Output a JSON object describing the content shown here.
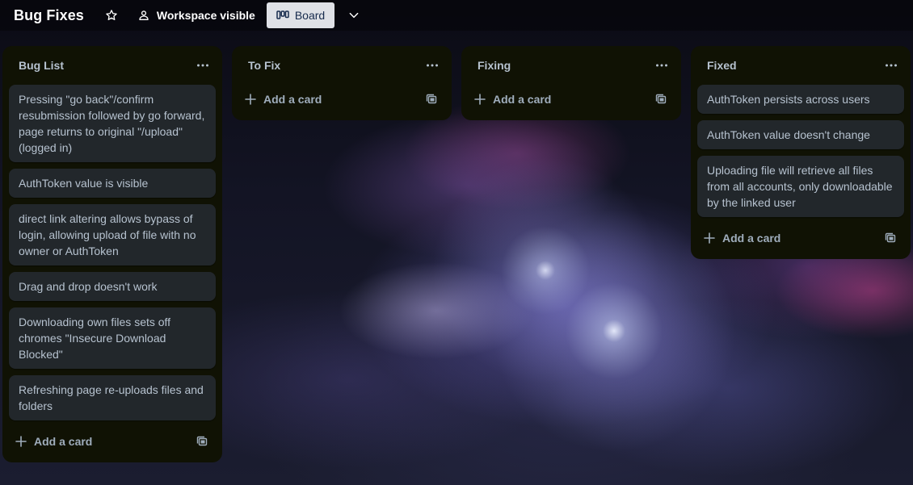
{
  "header": {
    "board_title": "Bug Fixes",
    "visibility_label": "Workspace visible",
    "view_label": "Board",
    "icons": {
      "star": "star-icon",
      "visibility": "people-icon",
      "board_view": "board-view-icon",
      "chevron": "chevron-down-icon"
    }
  },
  "colors": {
    "list_bg": "#101204",
    "card_bg": "#22272b",
    "text": "#b6c2cf",
    "view_button_bg": "#dfe1e6"
  },
  "add_card_label": "Add a card",
  "lists": [
    {
      "title": "Bug List",
      "cards": [
        "Pressing \"go back\"/confirm resubmission followed by go forward, page returns to original \"/upload\" (logged in)",
        "AuthToken value is visible",
        "direct link altering allows bypass of login, allowing upload of file with no owner or AuthToken",
        "Drag and drop doesn't work",
        "Downloading own files sets off chromes \"Insecure Download Blocked\"",
        "Refreshing page re-uploads files and folders"
      ]
    },
    {
      "title": "To Fix",
      "cards": []
    },
    {
      "title": "Fixing",
      "cards": []
    },
    {
      "title": "Fixed",
      "cards": [
        "AuthToken persists across users",
        "AuthToken value doesn't change",
        "Uploading file will retrieve all files from all accounts, only downloadable by the linked user"
      ]
    }
  ]
}
